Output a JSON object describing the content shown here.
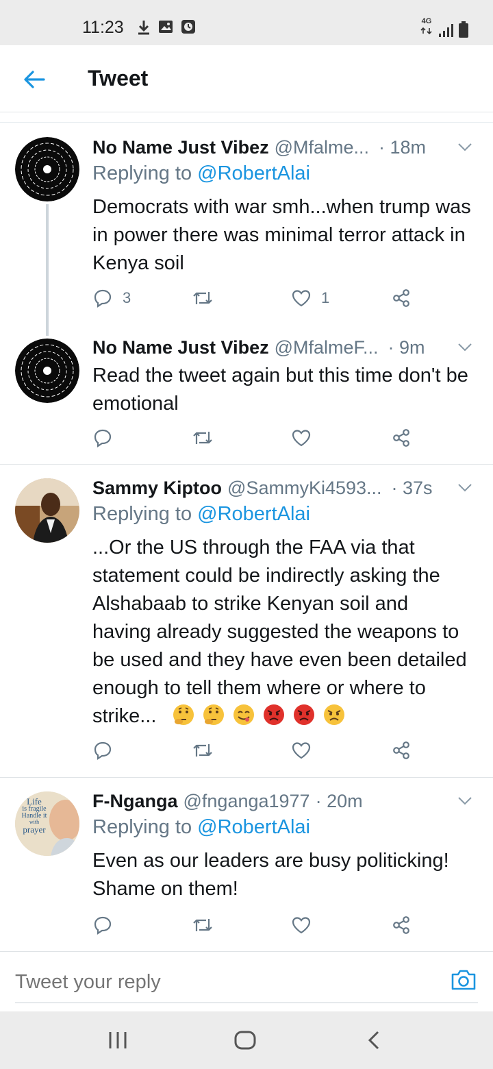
{
  "status_bar": {
    "time": "11:23",
    "network": "4G",
    "icons": [
      "download-icon",
      "image-icon",
      "alarm-icon",
      "signal-icon",
      "battery-icon"
    ]
  },
  "header": {
    "title": "Tweet",
    "back_icon": "arrow-left-icon"
  },
  "tweets": [
    {
      "name": "No Name Just Vibez",
      "handle": "@Mfalme...",
      "time": "· 18m",
      "reply_prefix": "Replying to",
      "reply_mention": "@RobertAlai",
      "text": "Democrats with war smh...when trump was in power there was minimal terror attack in Kenya soil",
      "replies": "3",
      "retweets": "",
      "likes": "1"
    },
    {
      "name": "No Name Just Vibez",
      "handle": "@MfalmeF...",
      "time": "· 9m",
      "text": "Read the tweet again but this time don't be emotional",
      "replies": "",
      "retweets": "",
      "likes": ""
    },
    {
      "name": "Sammy Kiptoo",
      "handle": "@SammyKi4593...",
      "time": "· 37s",
      "reply_prefix": "Replying to",
      "reply_mention": "@RobertAlai",
      "text_lines": [
        "...Or the US through the FAA via that",
        "statement could be indirectly asking the",
        "Alshabaab to strike Kenyan soil and",
        "having already suggested the weapons to",
        "be used and they have even been detailed",
        "enough to tell them where or where to"
      ],
      "text_last": "strike...",
      "emojis": [
        "thinking-face",
        "thinking-face",
        "face-savoring-food",
        "angry-face",
        "angry-face",
        "angry-face-yellow"
      ]
    },
    {
      "name": "F-Nganga",
      "handle": "@fnganga1977",
      "time": "· 20m",
      "reply_prefix": "Replying to",
      "reply_mention": "@RobertAlai",
      "text": "Even as our leaders are busy politicking! Shame on them!",
      "avatar_text": [
        "Life",
        "is fragile",
        "Handle it",
        "with",
        "prayer"
      ]
    }
  ],
  "composer": {
    "placeholder": "Tweet your reply",
    "camera_icon": "camera-icon"
  },
  "nav": {
    "buttons": [
      "recent-apps-icon",
      "home-icon",
      "back-icon"
    ]
  },
  "colors": {
    "accent": "#1b95e0",
    "muted": "#657786",
    "angry": "#e0312b"
  }
}
